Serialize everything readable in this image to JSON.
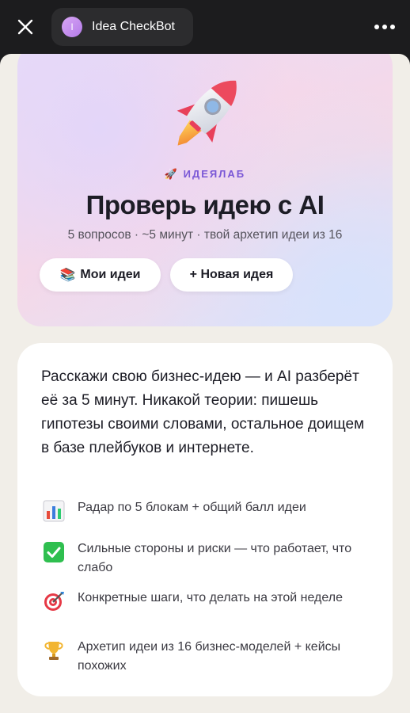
{
  "header": {
    "bot_initial": "I",
    "bot_name": "Idea CheckBot"
  },
  "hero": {
    "eyebrow_emoji": "🚀",
    "eyebrow": "ИДЕЯЛАБ",
    "title": "Проверь идею  с AI",
    "subtitle": "5 вопросов · ~5 минут · твой архетип идеи из 16",
    "my_ideas_emoji": "📚",
    "my_ideas_label": "Мои идеи",
    "new_idea_label": "+ Новая идея"
  },
  "card": {
    "intro": "Расскажи свою бизнес-идею — и AI разберёт её за 5 минут. Никакой теории: пишешь гипотезы своими словами, остальное доищем в базе плейбуков и интернете.",
    "features": [
      {
        "icon": "bar-chart-icon",
        "text": "Радар по 5 блокам + общий балл идеи"
      },
      {
        "icon": "check-mark-icon",
        "text": "Сильные стороны и риски — что работает, что слабо"
      },
      {
        "icon": "target-icon",
        "text": "Конкретные шаги, что делать на этой неделе"
      },
      {
        "icon": "trophy-icon",
        "text": "Архетип идеи из 16 бизнес-моделей + кейсы похожих"
      }
    ]
  },
  "colors": {
    "accent": "#7a57d6",
    "top_bar": "#1c1c1e",
    "page_bg": "#f1eee8"
  }
}
